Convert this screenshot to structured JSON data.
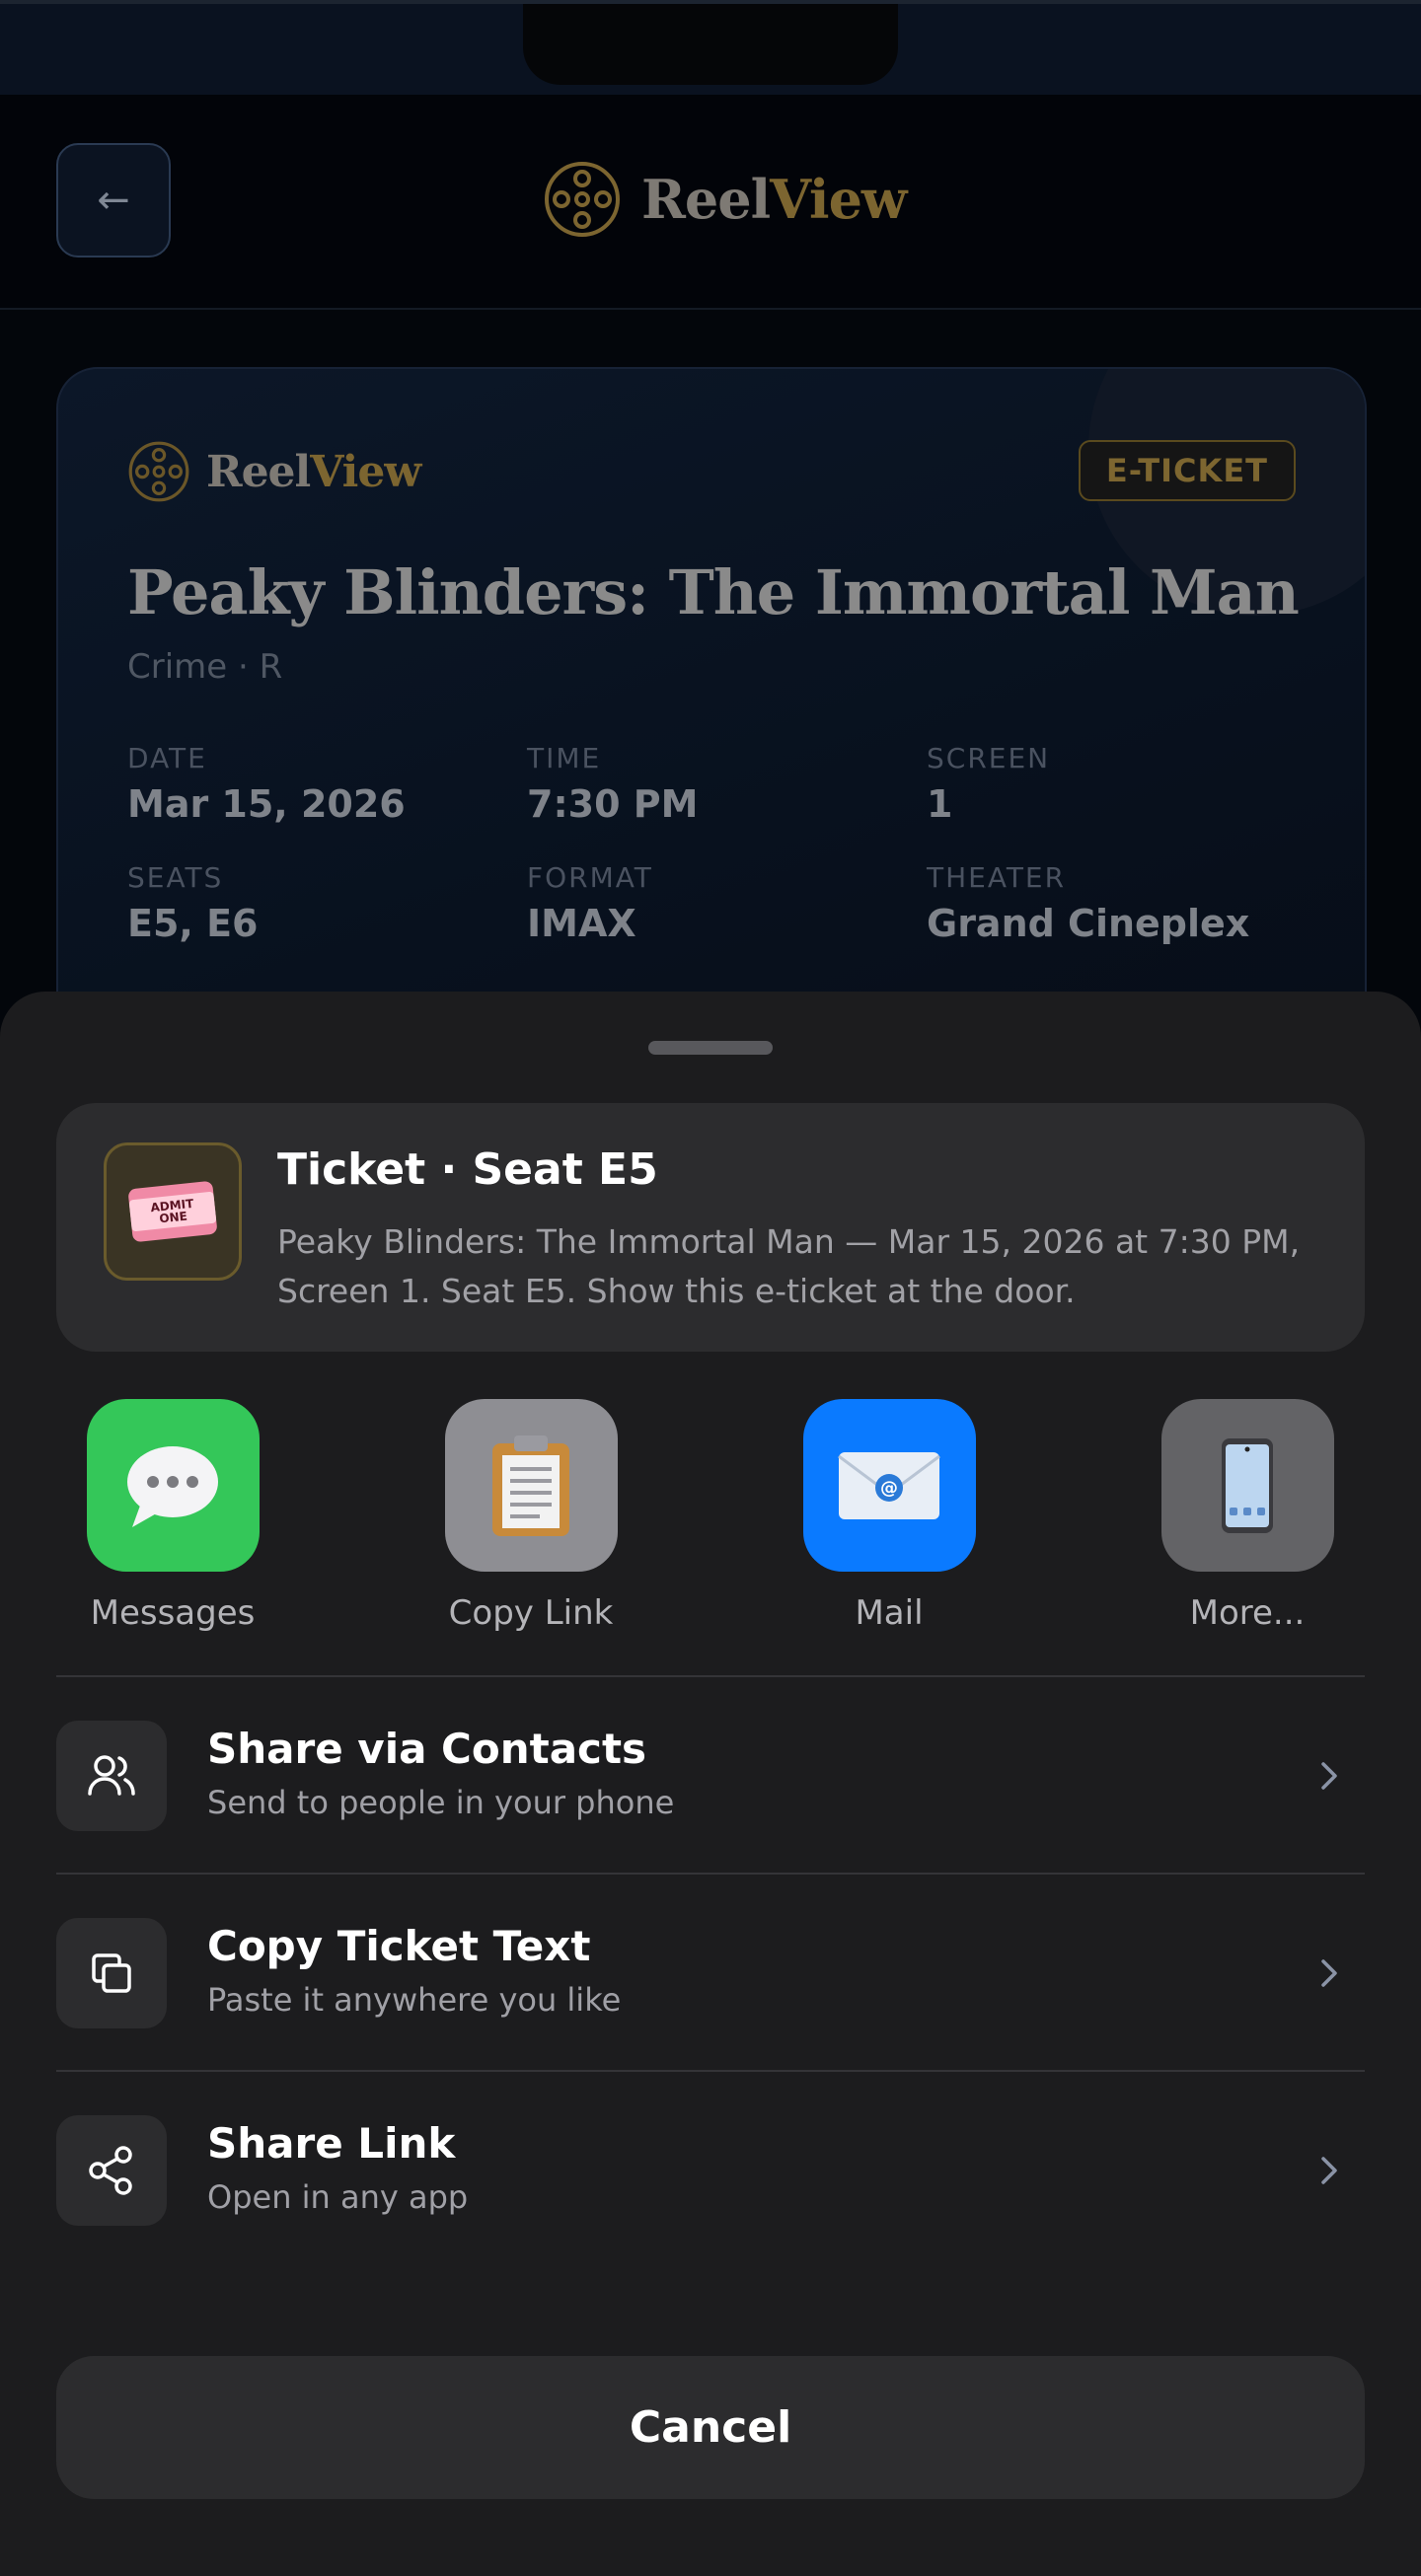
{
  "app": {
    "brand_part1": "Reel",
    "brand_part2": "View",
    "back_label": "←"
  },
  "ticket": {
    "brand_part1": "Reel",
    "brand_part2": "View",
    "badge": "E-TICKET",
    "title": "Peaky Blinders: The Immortal Man",
    "meta": "Crime · R",
    "fields": [
      {
        "label": "DATE",
        "value": "Mar 15, 2026"
      },
      {
        "label": "TIME",
        "value": "7:30 PM"
      },
      {
        "label": "SCREEN",
        "value": "1"
      },
      {
        "label": "SEATS",
        "value": "E5, E6"
      },
      {
        "label": "FORMAT",
        "value": "IMAX"
      },
      {
        "label": "THEATER",
        "value": "Grand Cineplex"
      }
    ]
  },
  "share_sheet": {
    "preview": {
      "title": "Ticket · Seat E5",
      "description": "Peaky Blinders: The Immortal Man — Mar 15, 2026 at 7:30 PM, Screen 1. Seat E5. Show this e-ticket at the door.",
      "thumb_text": "ADMIT ONE"
    },
    "apps": [
      {
        "label": "Messages",
        "icon": "messages-icon",
        "color": "#34c759"
      },
      {
        "label": "Copy Link",
        "icon": "clipboard-icon",
        "color": "#8e8e93"
      },
      {
        "label": "Mail",
        "icon": "mail-icon",
        "color": "#0a7aff"
      },
      {
        "label": "More...",
        "icon": "phone-icon",
        "color": "#636366"
      }
    ],
    "actions": [
      {
        "title": "Share via Contacts",
        "subtitle": "Send to people in your phone",
        "icon": "contacts-icon"
      },
      {
        "title": "Copy Ticket Text",
        "subtitle": "Paste it anywhere you like",
        "icon": "copy-icon"
      },
      {
        "title": "Share Link",
        "subtitle": "Open in any app",
        "icon": "share-icon"
      }
    ],
    "cancel_label": "Cancel"
  },
  "colors": {
    "accent_gold": "#7c6530",
    "sheet_bg": "#1c1c1e",
    "card_bg": "#2c2c2e"
  }
}
